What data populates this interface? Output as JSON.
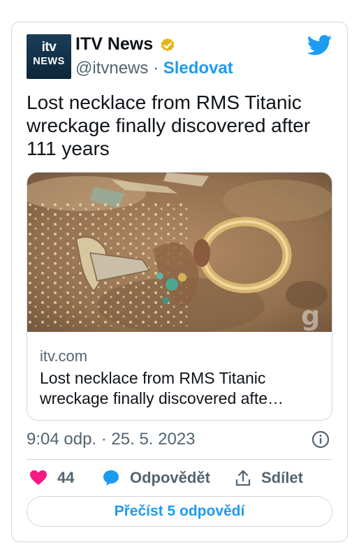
{
  "account": {
    "logo_top": "itv",
    "logo_bottom": "NEWS",
    "name": "ITV News",
    "handle": "@itvnews",
    "separator": "·",
    "follow_label": "Sledovat"
  },
  "tweet": {
    "text": "Lost necklace from RMS Titanic wreckage finally discovered after 111 years"
  },
  "link_card": {
    "domain": "itv.com",
    "title": "Lost necklace from RMS Titanic wreckage finally discovered afte…",
    "watermark": "g"
  },
  "meta": {
    "timestamp": "9:04 odp. · 25. 5. 2023"
  },
  "actions": {
    "likes": "44",
    "reply_label": "Odpovědět",
    "share_label": "Sdílet"
  },
  "read_replies_label": "Přečíst 5 odpovědí",
  "colors": {
    "accent": "#1d9bf0",
    "like": "#f91880",
    "verified": "#e2b719",
    "secondary_text": "#536471",
    "border": "#cfd9de"
  },
  "icons": [
    "verified-badge-icon",
    "twitter-bird-icon",
    "info-icon",
    "heart-icon",
    "reply-bubble-icon",
    "share-icon"
  ]
}
